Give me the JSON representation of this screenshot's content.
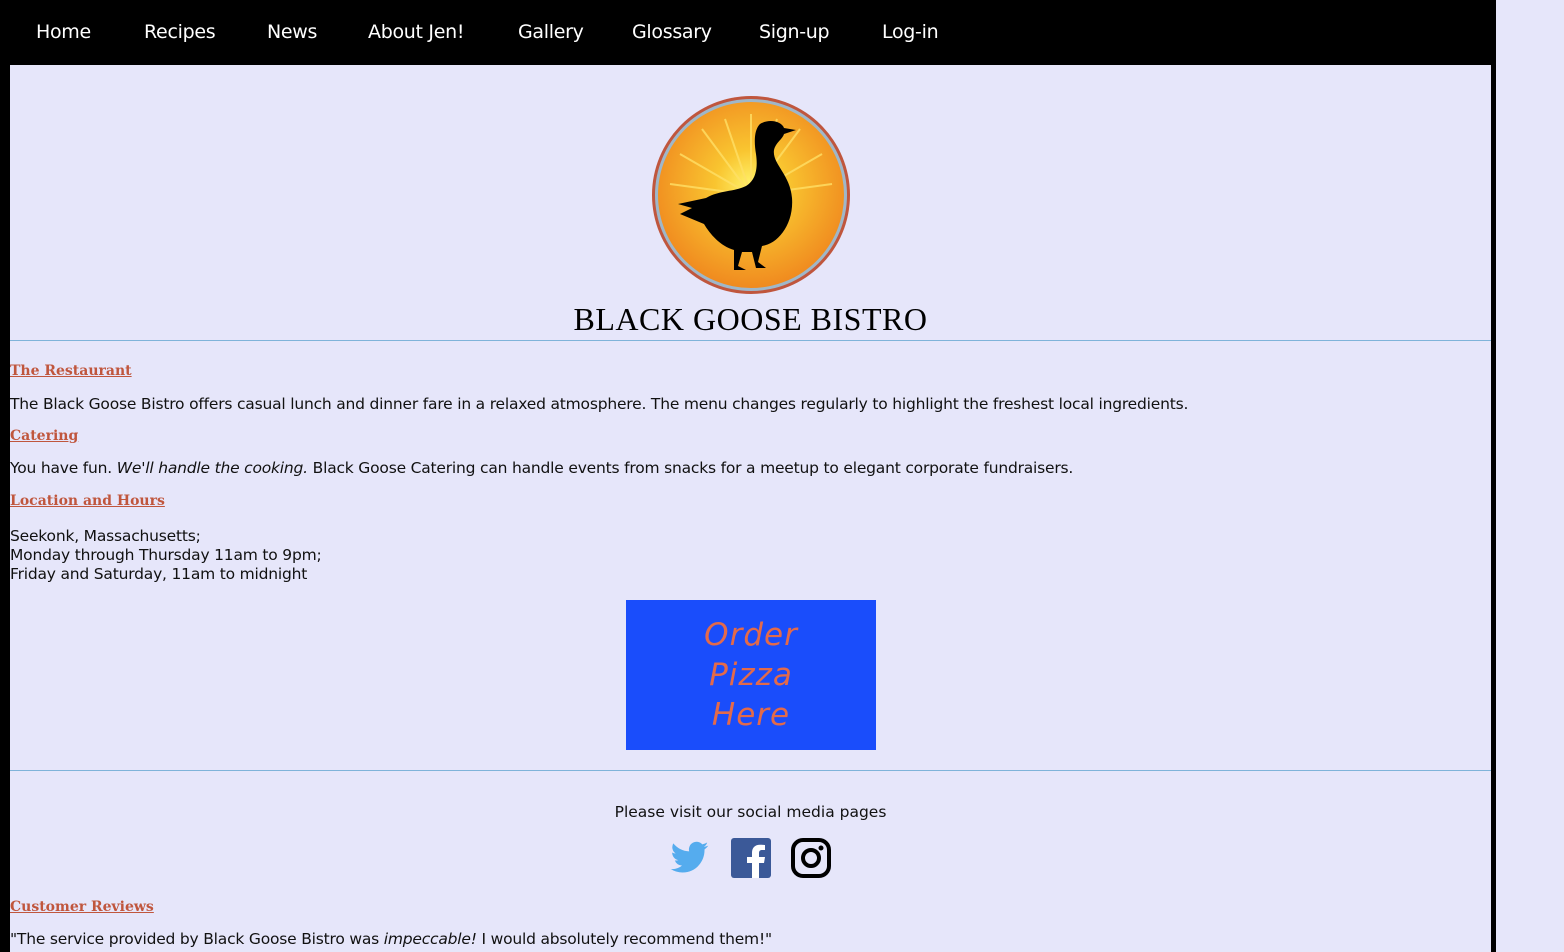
{
  "nav": {
    "items": [
      "Home",
      "Recipes",
      "News",
      "About Jen!",
      "Gallery",
      "Glossary",
      "Sign-up",
      "Log-in"
    ]
  },
  "header": {
    "logo_icon": "black-goose-sunburst-logo",
    "title": "BLACK GOOSE BISTRO"
  },
  "sections": {
    "restaurant": {
      "heading": "The Restaurant",
      "text": "The Black Goose Bistro offers casual lunch and dinner fare in a relaxed atmosphere. The menu changes regularly to highlight the freshest local ingredients."
    },
    "catering": {
      "heading": "Catering",
      "text_start": "You have fun. ",
      "text_emphasis": "We'll handle the cooking.",
      "text_end": " Black Goose Catering can handle events from snacks for a meetup to elegant corporate fundraisers."
    },
    "location": {
      "heading": "Location and Hours",
      "lines": [
        "Seekonk, Massachusetts;",
        "Monday through Thursday 11am to 9pm;",
        "Friday and Saturday, 11am to midnight"
      ]
    }
  },
  "order_button": {
    "label": "Order\nPizza\nHere"
  },
  "social": {
    "caption": "Please visit our social media pages",
    "icons": [
      "twitter-icon",
      "facebook-icon",
      "instagram-icon"
    ]
  },
  "reviews": {
    "heading": "Customer Reviews",
    "quote_start": "\"The service provided by Black Goose Bistro was ",
    "quote_emphasis": "impeccable!",
    "quote_end": " I would absolutely recommend them!\""
  },
  "colors": {
    "background": "#e6e6fa",
    "nav_background": "#000000",
    "heading_accent": "#c0563d",
    "order_button_bg": "#1a4dfb",
    "order_button_text": "#e36a4a",
    "divider": "#7fb3d9",
    "twitter_blue": "#55acee",
    "facebook_blue": "#3b5998"
  }
}
